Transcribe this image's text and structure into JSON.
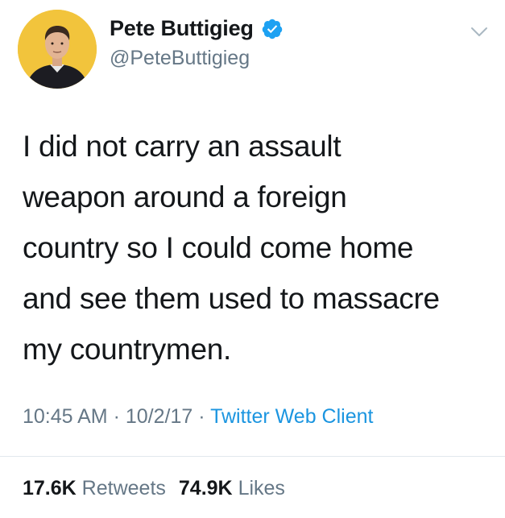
{
  "user": {
    "display_name": "Pete Buttigieg",
    "handle": "@PeteButtigieg",
    "verified": true
  },
  "icons": {
    "verified": "verified-badge-icon",
    "menu": "chevron-down-icon",
    "avatar": "profile-avatar"
  },
  "tweet": {
    "text": "I did not carry an assault\nweapon around a foreign\ncountry so I could come home\nand see them used to massacre\nmy countrymen.",
    "time": "10:45 AM",
    "separator": "·",
    "date": "10/2/17",
    "source": "Twitter Web Client"
  },
  "stats": {
    "retweets_count": "17.6K",
    "retweets_label": "Retweets",
    "likes_count": "74.9K",
    "likes_label": "Likes"
  },
  "colors": {
    "text": "#14171a",
    "secondary": "#657786",
    "link": "#1b95e0",
    "verified": "#1da1f2",
    "avatar_bg": "#f2c43c",
    "divider": "#e1e8ed"
  }
}
